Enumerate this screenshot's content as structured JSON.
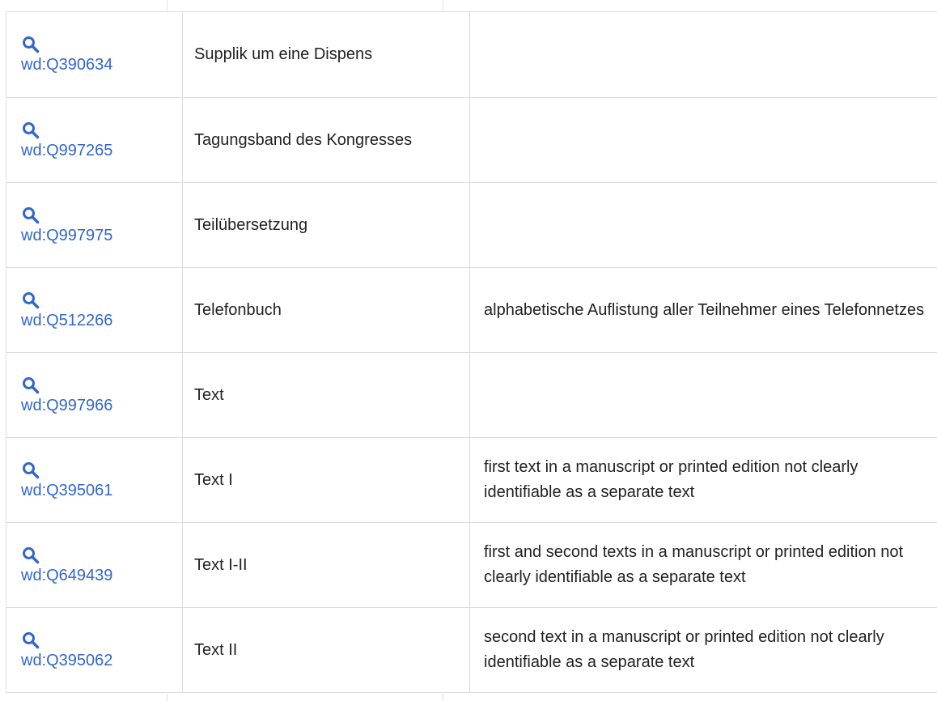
{
  "rows": [
    {
      "id": "wd:Q390634",
      "label": "Supplik um eine Dispens",
      "description": ""
    },
    {
      "id": "wd:Q997265",
      "label": "Tagungsband des Kongresses",
      "description": ""
    },
    {
      "id": "wd:Q997975",
      "label": "Teilübersetzung",
      "description": ""
    },
    {
      "id": "wd:Q512266",
      "label": "Telefonbuch",
      "description": "alphabetische Auflistung aller Teilnehmer eines Telefonnetzes"
    },
    {
      "id": "wd:Q997966",
      "label": "Text",
      "description": ""
    },
    {
      "id": "wd:Q395061",
      "label": "Text I",
      "description": "first text in a manuscript or printed edition not clearly identifiable as a separate text"
    },
    {
      "id": "wd:Q649439",
      "label": "Text I-II",
      "description": "first and second texts in a manuscript or printed edition not clearly identifiable as a separate text"
    },
    {
      "id": "wd:Q395062",
      "label": "Text II",
      "description": "second text in a manuscript or printed edition not clearly identifiable as a separate text"
    }
  ],
  "icons": {
    "explore": "search-icon"
  },
  "colors": {
    "link": "#3366cc",
    "border": "#dcdcdc",
    "text": "#222222"
  }
}
